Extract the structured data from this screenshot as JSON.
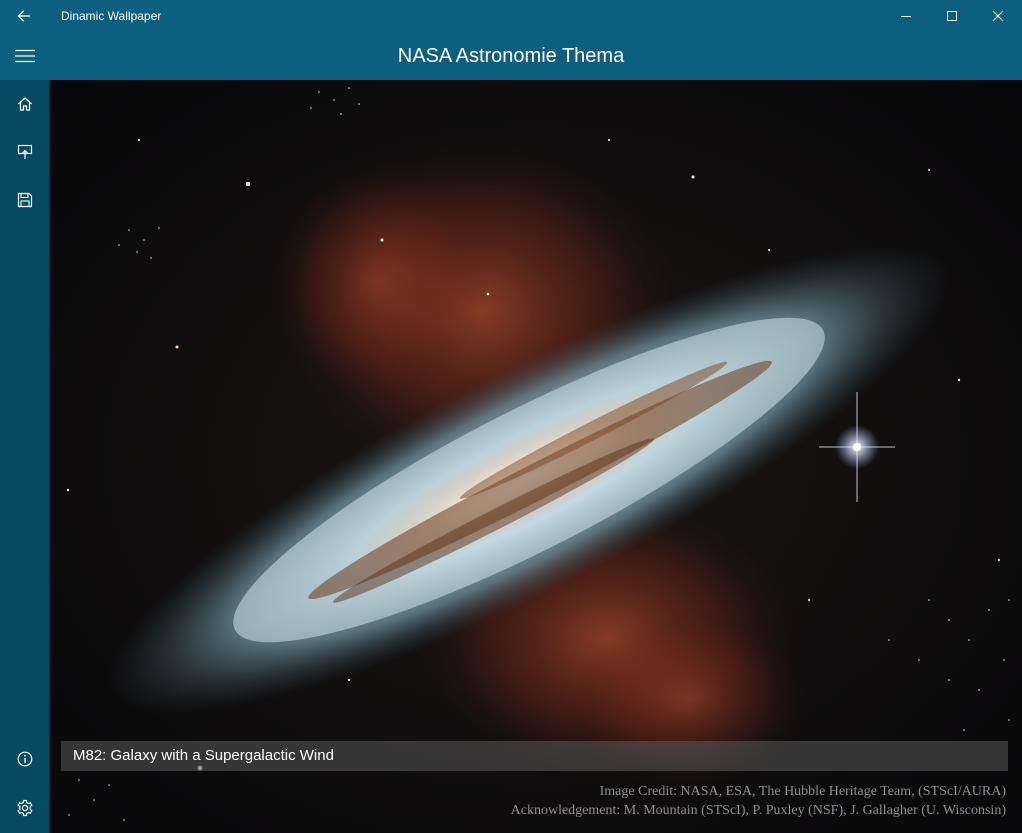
{
  "window": {
    "title": "Dinamic Wallpaper"
  },
  "header": {
    "title": "NASA Astronomie Thema"
  },
  "icons": {
    "back": "back-arrow-icon",
    "minimize": "minimize-icon",
    "maximize": "maximize-icon",
    "close": "close-icon",
    "menu": "hamburger-icon",
    "home": "home-icon",
    "set_wallpaper": "set-wallpaper-icon",
    "save": "save-icon",
    "info": "info-icon",
    "settings": "gear-icon"
  },
  "image": {
    "title": "M82: Galaxy with a Supergalactic Wind",
    "credit_line": "Image Credit: NASA, ESA, The Hubble Heritage Team, (STScI/AURA)",
    "acknowledgement_line": "Acknowledgement: M. Mountain (STScI), P. Puxley (NSF), J. Gallagher (U. Wisconsin)"
  },
  "colors": {
    "accent": "#0c5f7f",
    "sidebar": "#074b63"
  }
}
